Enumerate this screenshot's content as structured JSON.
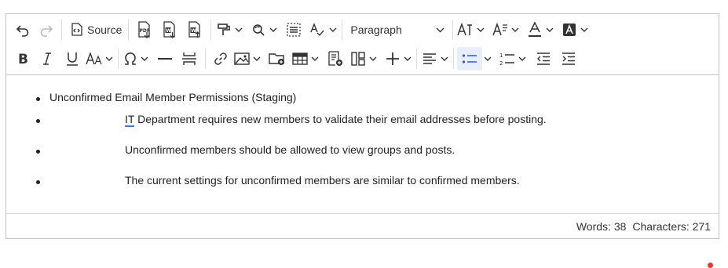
{
  "toolbar": {
    "source_label": "Source",
    "block_format": "Paragraph"
  },
  "content": {
    "items": [
      {
        "text": "Unconfirmed Email Member Permissions (Staging)"
      },
      {
        "prefix": "IT",
        "text": " Department requires new members to validate their email addresses before posting."
      },
      {
        "text": "Unconfirmed members should be allowed to view groups and posts."
      },
      {
        "text": "The current settings for unconfirmed members are similar to confirmed members."
      }
    ]
  },
  "status": {
    "words": "Words: 38",
    "characters": "Characters: 271"
  },
  "colors": {
    "active_tool": "#1f5fd1",
    "spellcheck_underline": "#3a7bd5",
    "notification_dot": "#e53935"
  }
}
